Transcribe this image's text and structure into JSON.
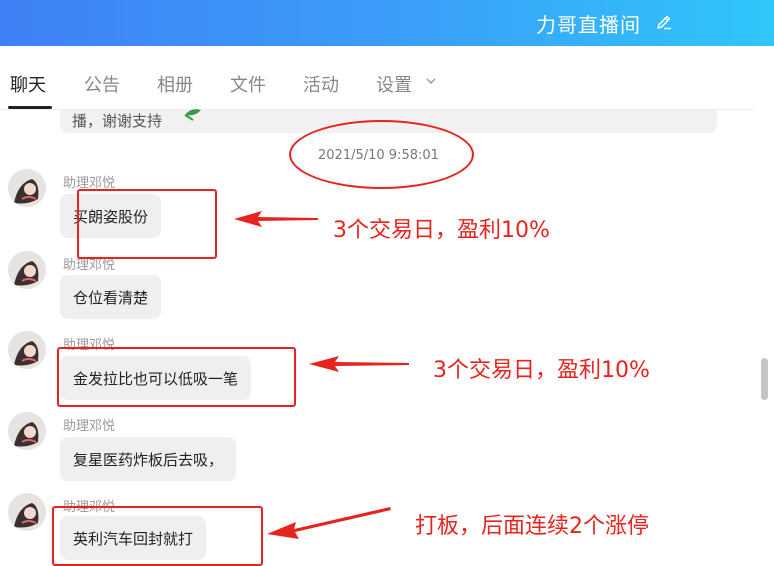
{
  "header": {
    "title": "力哥直播间",
    "edit_icon": "pencil-icon"
  },
  "tabs": [
    {
      "label": "聊天",
      "active": true
    },
    {
      "label": "公告"
    },
    {
      "label": "相册"
    },
    {
      "label": "文件"
    },
    {
      "label": "活动"
    },
    {
      "label": "设置"
    }
  ],
  "chat": {
    "prev_message": "播，谢谢支持",
    "timestamp": "2021/5/10 9:58:01",
    "messages": [
      {
        "sender": "助理邓悦",
        "text": "买朗姿股份"
      },
      {
        "sender": "助理邓悦",
        "text": "仓位看清楚"
      },
      {
        "sender": "助理邓悦",
        "text": "金发拉比也可以低吸一笔"
      },
      {
        "sender": "助理邓悦",
        "text": "复星医药炸板后去吸，"
      },
      {
        "sender": "助理邓悦",
        "text": "英利汽车回封就打"
      }
    ]
  },
  "annotations": {
    "note1": "3个交易日，盈利10%",
    "note2": "3个交易日，盈利10%",
    "note3": "打板，后面连续2个涨停"
  },
  "colors": {
    "accent_red": "#e8231e",
    "header_start": "#3f80f6",
    "header_end": "#2fc6fb"
  }
}
